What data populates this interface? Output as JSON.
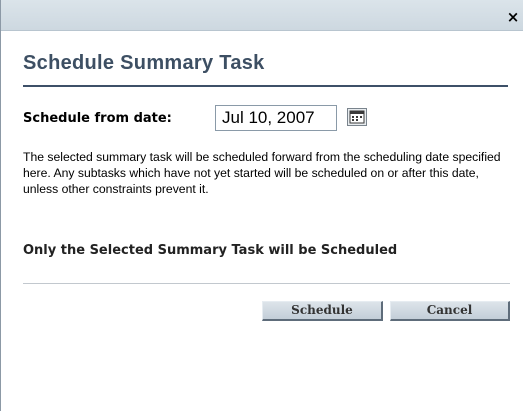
{
  "dialog": {
    "close_glyph": "×",
    "heading": "Schedule Summary Task",
    "date_label": "Schedule from date:",
    "date_value": "Jul 10, 2007",
    "calendar_icon": "calendar-icon",
    "description": "The selected summary task will be scheduled forward from the scheduling date specified here. Any subtasks which have not yet started will be scheduled on or after this date, unless other constraints prevent it.",
    "notice": "Only the Selected Summary Task will be Scheduled",
    "buttons": {
      "schedule": "Schedule",
      "cancel": "Cancel"
    }
  },
  "colors": {
    "heading": "#3d4f63",
    "title_bar": "#d3dde4",
    "button_face": "#c9d3dc"
  }
}
